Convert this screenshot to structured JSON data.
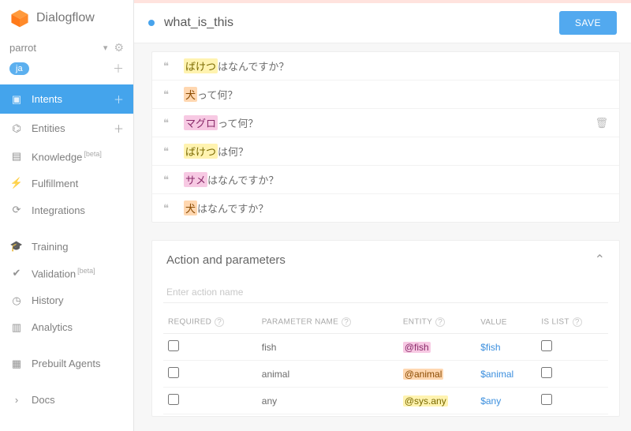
{
  "brand": "Dialogflow",
  "agent": {
    "name": "parrot",
    "lang": "ja"
  },
  "sidebar": {
    "items": [
      {
        "label": "Intents",
        "icon": "intents",
        "active": true,
        "add": true,
        "beta": false
      },
      {
        "label": "Entities",
        "icon": "entities",
        "active": false,
        "add": true,
        "beta": false
      },
      {
        "label": "Knowledge",
        "icon": "knowledge",
        "active": false,
        "add": false,
        "beta": true
      },
      {
        "label": "Fulfillment",
        "icon": "fulfill",
        "active": false,
        "add": false,
        "beta": false
      },
      {
        "label": "Integrations",
        "icon": "integrate",
        "active": false,
        "add": false,
        "beta": false
      },
      {
        "label": "Training",
        "icon": "training",
        "active": false,
        "add": false,
        "beta": false
      },
      {
        "label": "Validation",
        "icon": "validate",
        "active": false,
        "add": false,
        "beta": true
      },
      {
        "label": "History",
        "icon": "history",
        "active": false,
        "add": false,
        "beta": false
      },
      {
        "label": "Analytics",
        "icon": "analytics",
        "active": false,
        "add": false,
        "beta": false
      },
      {
        "label": "Prebuilt Agents",
        "icon": "prebuilt",
        "active": false,
        "add": false,
        "beta": false
      },
      {
        "label": "Docs",
        "icon": "docs",
        "active": false,
        "add": false,
        "beta": false
      }
    ],
    "beta_tag": "[beta]"
  },
  "intent": {
    "title": "what_is_this",
    "save_label": "SAVE"
  },
  "phrases": [
    {
      "parts": [
        {
          "t": "ばけつ",
          "hl": "yellow"
        },
        {
          "t": "はなんですか？"
        }
      ]
    },
    {
      "parts": [
        {
          "t": "犬",
          "hl": "orange"
        },
        {
          "t": "って何？"
        }
      ]
    },
    {
      "parts": [
        {
          "t": "マグロ",
          "hl": "pink"
        },
        {
          "t": "って何？"
        }
      ],
      "hovered": true
    },
    {
      "parts": [
        {
          "t": "ばけつ",
          "hl": "yellow"
        },
        {
          "t": "は何？"
        }
      ]
    },
    {
      "parts": [
        {
          "t": "サメ",
          "hl": "pink"
        },
        {
          "t": "はなんですか？"
        }
      ]
    },
    {
      "parts": [
        {
          "t": "犬",
          "hl": "orange"
        },
        {
          "t": "はなんですか？"
        }
      ]
    }
  ],
  "params": {
    "section_title": "Action and parameters",
    "action_placeholder": "Enter action name",
    "headers": {
      "required": "REQUIRED",
      "name": "PARAMETER NAME",
      "entity": "ENTITY",
      "value": "VALUE",
      "islist": "IS LIST"
    },
    "rows": [
      {
        "name": "fish",
        "entity": "@fish",
        "entity_hl": "pink",
        "value": "$fish"
      },
      {
        "name": "animal",
        "entity": "@animal",
        "entity_hl": "orange",
        "value": "$animal"
      },
      {
        "name": "any",
        "entity": "@sys.any",
        "entity_hl": "yellow",
        "value": "$any"
      }
    ]
  }
}
